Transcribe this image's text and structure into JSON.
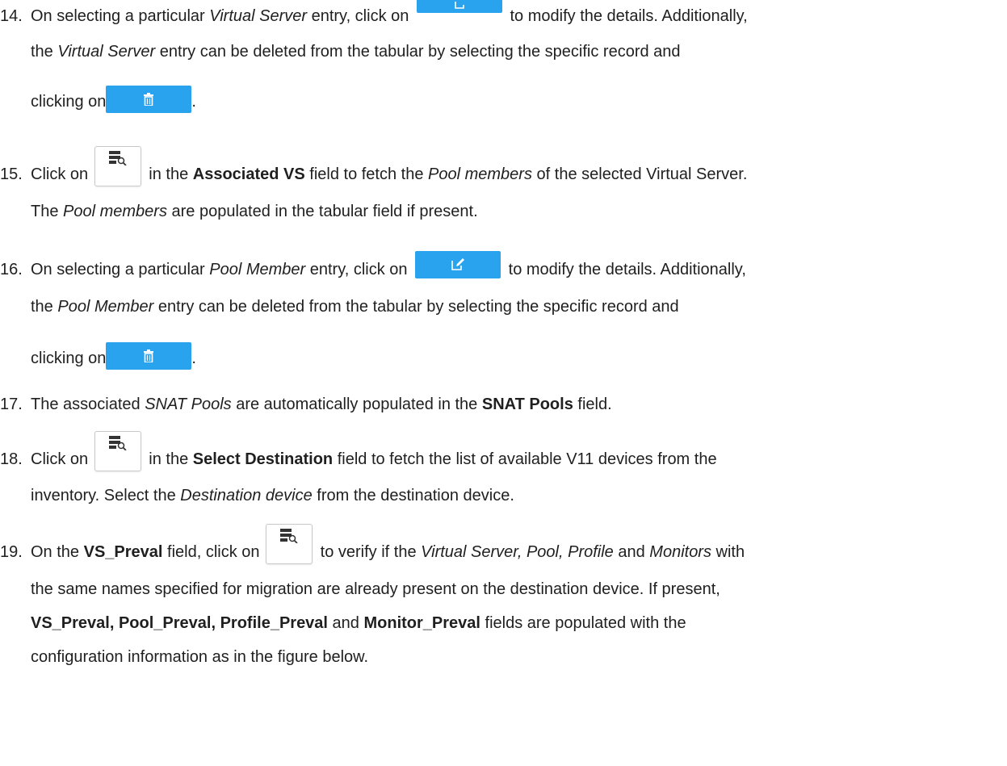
{
  "steps": [
    {
      "number": "14.",
      "l1_a": "On selecting a particular ",
      "l1_em": "Virtual Server",
      "l1_b": " entry, click on",
      "l1_c": "to modify the details. Additionally,",
      "l2_a": "the ",
      "l2_em": "Virtual Server",
      "l2_b": " entry can be deleted from the tabular by selecting the specific record and",
      "l3_a": "clicking on",
      "l3_b": "."
    },
    {
      "number": "15.",
      "l1_a": "Click on",
      "l1_b": "in the ",
      "l1_strong": "Associated VS",
      "l1_c": " field to fetch the ",
      "l1_em": "Pool members",
      "l1_d": " of the selected Virtual Server.",
      "l2_a": "The ",
      "l2_em": "Pool members",
      "l2_b": " are populated in the tabular field if present."
    },
    {
      "number": "16.",
      "l1_a": "On selecting a particular ",
      "l1_em": "Pool Member",
      "l1_b": " entry, click on",
      "l1_c": "to modify the details. Additionally,",
      "l2_a": "the ",
      "l2_em": "Pool Member",
      "l2_b": " entry can be deleted from the tabular by selecting the specific record and",
      "l3_a": "clicking on",
      "l3_b": "."
    },
    {
      "number": "17.",
      "l1_a": "The associated ",
      "l1_em": "SNAT Pools",
      "l1_b": " are automatically populated in the ",
      "l1_strong": "SNAT Pools",
      "l1_c": " field."
    },
    {
      "number": "18.",
      "l1_a": "Click on",
      "l1_b": "in the ",
      "l1_strong": "Select Destination",
      "l1_c": " field to fetch the list of available V11 devices from the",
      "l2_a": "inventory. Select the ",
      "l2_em": "Destination device",
      "l2_b": " from the destination device."
    },
    {
      "number": "19.",
      "l1_a": "On the ",
      "l1_strong": "VS_Preval",
      "l1_b": " field, click on",
      "l1_c": "to verify if the ",
      "l1_em": "Virtual Server, Pool, Profile",
      "l1_d": " and ",
      "l1_em2": "Monitors",
      "l1_e": " with",
      "l2_a": "the same names specified for migration are already present on the destination device. If present,",
      "l3_strong": "VS_Preval, Pool_Preval, Profile_Preval",
      "l3_a": " and ",
      "l3_strong2": "Monitor_Preval",
      "l3_b": " fields are populated with the",
      "l4_a": "configuration information as in the figure below."
    }
  ],
  "icons": {
    "edit": "edit-icon",
    "delete": "trash-icon",
    "fetch": "server-search-icon"
  },
  "colors": {
    "button_blue": "#2aa3ee",
    "text": "#1f1f1f"
  }
}
